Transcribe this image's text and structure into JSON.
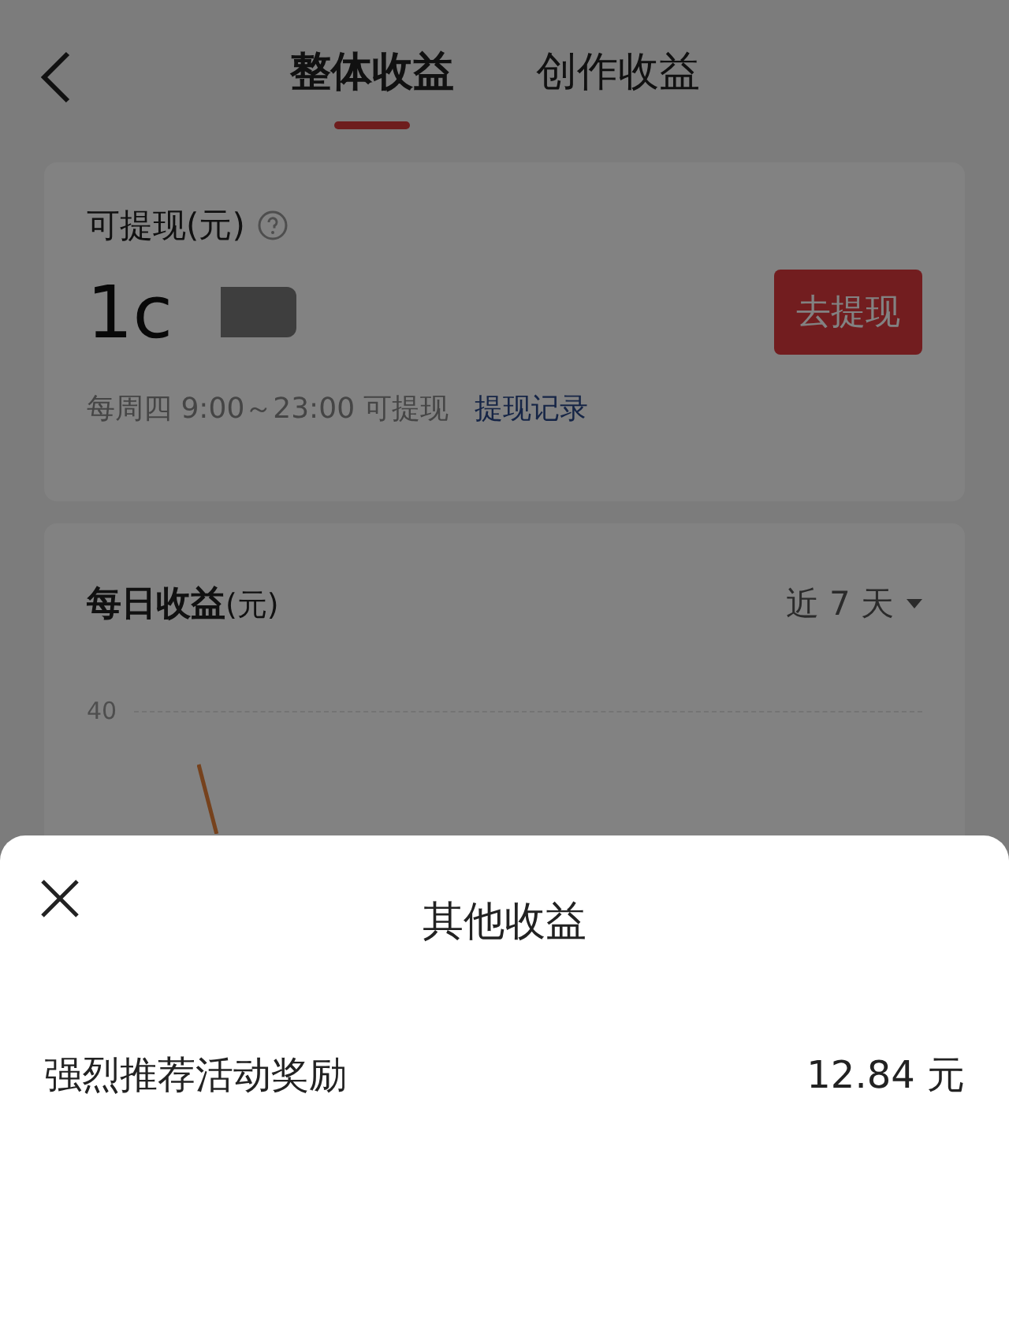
{
  "nav": {
    "tabs": [
      {
        "label": "整体收益",
        "selected": true
      },
      {
        "label": "创作收益",
        "selected": false
      }
    ]
  },
  "withdraw_card": {
    "label": "可提现(元)",
    "amount": "1c",
    "button": "去提现",
    "schedule": "每周四 9:00～23:00 可提现",
    "link": "提现记录"
  },
  "daily_card": {
    "title": "每日收益",
    "unit": "(元)",
    "range": "近 7 天",
    "axis_labels": [
      "40"
    ]
  },
  "sheet": {
    "title": "其他收益",
    "rows": [
      {
        "label": "强烈推荐活动奖励",
        "value": "12.84 元"
      }
    ]
  }
}
